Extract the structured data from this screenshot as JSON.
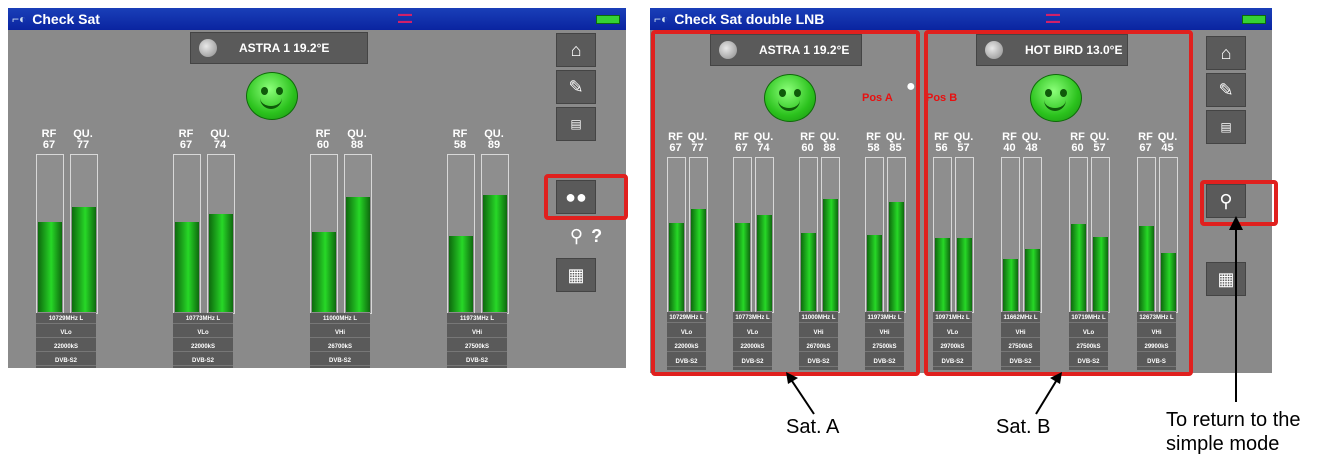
{
  "left": {
    "title": "Check Sat",
    "sat_label": "ASTRA 1 19.2°E",
    "bars": [
      {
        "rf_label": "RF",
        "rf_value": "67",
        "qu_label": "QU.",
        "qu_value": "77",
        "rf_level": 0.58,
        "qu_level": 0.67,
        "info": [
          "10729MHz L",
          "VLo",
          "22000kS",
          "DVB-S2"
        ]
      },
      {
        "rf_label": "RF",
        "rf_value": "67",
        "qu_label": "QU.",
        "qu_value": "74",
        "rf_level": 0.58,
        "qu_level": 0.63,
        "info": [
          "10773MHz L",
          "VLo",
          "22000kS",
          "DVB-S2"
        ]
      },
      {
        "rf_label": "RF",
        "rf_value": "60",
        "qu_label": "QU.",
        "qu_value": "88",
        "rf_level": 0.51,
        "qu_level": 0.74,
        "info": [
          "11000MHz L",
          "VHi",
          "26700kS",
          "DVB-S2"
        ]
      },
      {
        "rf_label": "RF",
        "rf_value": "58",
        "qu_label": "QU.",
        "qu_value": "89",
        "rf_level": 0.49,
        "qu_level": 0.75,
        "info": [
          "11973MHz L",
          "VHi",
          "27500kS",
          "DVB-S2"
        ]
      }
    ],
    "side_help": "?"
  },
  "right": {
    "title": "Check Sat double LNB",
    "satA_label": "ASTRA 1 19.2°E",
    "satB_label": "HOT BIRD 13.0°E",
    "posA": "Pos A",
    "posB": "Pos B",
    "satA_bars": [
      {
        "rf_label": "RF",
        "rf_value": "67",
        "qu_label": "QU.",
        "qu_value": "77",
        "rf_level": 0.58,
        "qu_level": 0.67,
        "info": [
          "10729MHz L",
          "VLo",
          "22000kS",
          "DVB-S2"
        ]
      },
      {
        "rf_label": "RF",
        "rf_value": "67",
        "qu_label": "QU.",
        "qu_value": "74",
        "rf_level": 0.58,
        "qu_level": 0.63,
        "info": [
          "10773MHz L",
          "VLo",
          "22000kS",
          "DVB-S2"
        ]
      },
      {
        "rf_label": "RF",
        "rf_value": "60",
        "qu_label": "QU.",
        "qu_value": "88",
        "rf_level": 0.51,
        "qu_level": 0.74,
        "info": [
          "11000MHz L",
          "VHi",
          "26700kS",
          "DVB-S2"
        ]
      },
      {
        "rf_label": "RF",
        "rf_value": "58",
        "qu_label": "QU.",
        "qu_value": "85",
        "rf_level": 0.5,
        "qu_level": 0.72,
        "info": [
          "11973MHz L",
          "VHi",
          "27500kS",
          "DVB-S2"
        ]
      }
    ],
    "satB_bars": [
      {
        "rf_label": "RF",
        "rf_value": "56",
        "qu_label": "QU.",
        "qu_value": "57",
        "rf_level": 0.48,
        "qu_level": 0.48,
        "info": [
          "10971MHz L",
          "VLo",
          "29700kS",
          "DVB-S2"
        ]
      },
      {
        "rf_label": "RF",
        "rf_value": "40",
        "qu_label": "QU.",
        "qu_value": "48",
        "rf_level": 0.34,
        "qu_level": 0.41,
        "info": [
          "11662MHz L",
          "VHi",
          "27500kS",
          "DVB-S2"
        ]
      },
      {
        "rf_label": "RF",
        "rf_value": "60",
        "qu_label": "QU.",
        "qu_value": "57",
        "rf_level": 0.57,
        "qu_level": 0.49,
        "info": [
          "10719MHz L",
          "VLo",
          "27500kS",
          "DVB-S2"
        ]
      },
      {
        "rf_label": "RF",
        "rf_value": "67",
        "qu_label": "QU.",
        "qu_value": "45",
        "rf_level": 0.56,
        "qu_level": 0.38,
        "info": [
          "12673MHz L",
          "VHi",
          "29900kS",
          "DVB-S"
        ]
      }
    ]
  },
  "captions": {
    "sat_a": "Sat. A",
    "sat_b": "Sat. B",
    "return_line1": "To return to the",
    "return_line2": "simple mode"
  },
  "icons": [
    "home-icon",
    "satellite-dish-icon",
    "spectrum-icon",
    "double-lnb-icon",
    "single-lnb-icon",
    "probe-help-icon",
    "calculator-icon"
  ],
  "colors": {
    "highlight": "#e0201e",
    "bar_green": "#22c222",
    "title_blue": "#0a24a0"
  }
}
